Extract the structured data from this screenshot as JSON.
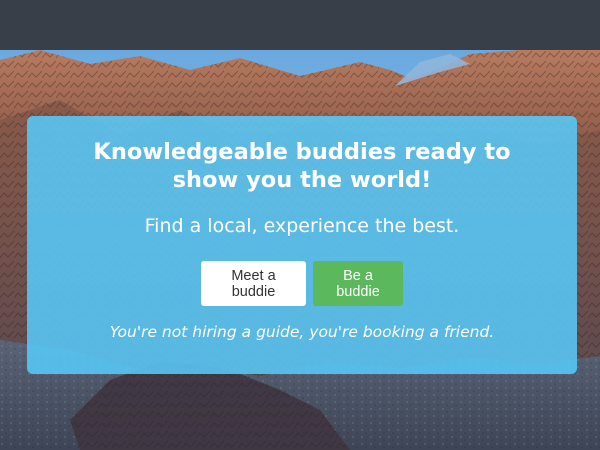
{
  "hero": {
    "headline": "Knowledgeable buddies ready to show you the world!",
    "subheadline": "Find a local, experience the best.",
    "tagline": "You're not hiring a guide, you're booking a friend."
  },
  "actions": {
    "meet_label": "Meet a buddie",
    "be_label": "Be a buddie"
  },
  "colors": {
    "topbar": "#383f48",
    "card_overlay": "#58c8f8",
    "primary_button": "#ffffff",
    "success_button": "#5cb85c"
  }
}
